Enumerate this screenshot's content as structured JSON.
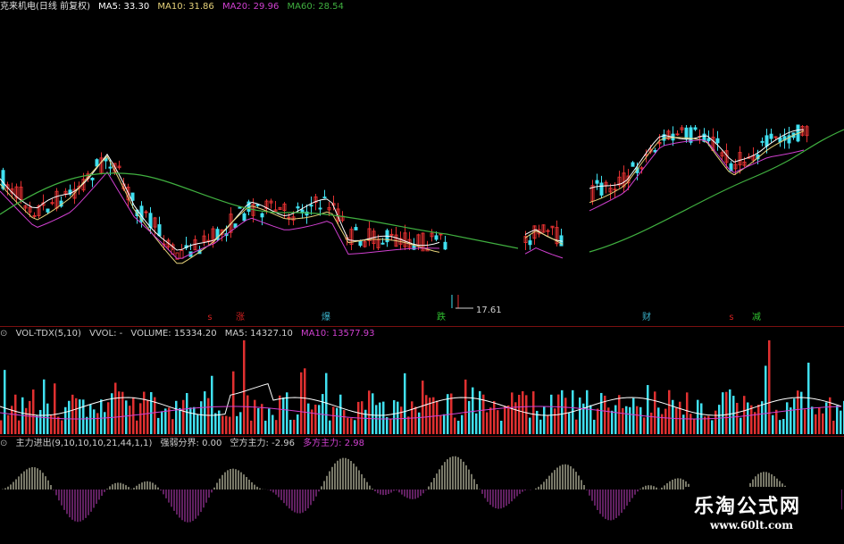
{
  "header_main": {
    "title": "克来机电(日线 前复权)",
    "ma5": "MA5: 33.30",
    "ma10": "MA10: 31.86",
    "ma20": "MA20: 29.96",
    "ma60": "MA60: 28.54"
  },
  "header_vol": {
    "title": "VOL-TDX(5,10)",
    "vvol": "VVOL: -",
    "volume": "VOLUME: 15334.20",
    "ma5": "MA5: 14327.10",
    "ma10": "MA10: 13577.93"
  },
  "header_ind": {
    "title": "主力进出(9,10,10,10,21,44,1,1)",
    "boundary": "强弱分界: 0.00",
    "bear": "空方主力: -2.96",
    "bull": "多方主力: 2.98"
  },
  "low_marker": "17.61",
  "tags": [
    {
      "text": "s",
      "color": "#d02020"
    },
    {
      "text": "涨",
      "color": "#d02020"
    },
    {
      "text": "爆",
      "color": "#3ab0c8"
    },
    {
      "text": "跌",
      "color": "#30c030"
    },
    {
      "text": "财",
      "color": "#3ab0c8"
    },
    {
      "text": "s",
      "color": "#d02020"
    },
    {
      "text": "减",
      "color": "#30c030"
    }
  ],
  "watermark": {
    "title": "乐淘公式网",
    "url": "www.60lt.com"
  },
  "colors": {
    "up": "#e03030",
    "down": "#40e0f0",
    "ma5": "#ffffff",
    "ma10": "#e6d27a",
    "ma20": "#d040d0",
    "ma60": "#40b040",
    "bull": "#c040c0",
    "bear": "#f0f0d0"
  },
  "chart_data": {
    "type": "candlestick",
    "series": [
      {
        "name": "MA5",
        "values": [
          33.3
        ]
      },
      {
        "name": "MA10",
        "values": [
          31.86
        ]
      },
      {
        "name": "MA20",
        "values": [
          29.96
        ]
      },
      {
        "name": "MA60",
        "values": [
          28.54
        ]
      }
    ],
    "volume": {
      "VOLUME": 15334.2,
      "MA5": 14327.1,
      "MA10": 13577.93
    },
    "indicator": {
      "强弱分界": 0.0,
      "空方主力": -2.96,
      "多方主力": 2.98
    },
    "annotations": [
      "17.61"
    ]
  }
}
